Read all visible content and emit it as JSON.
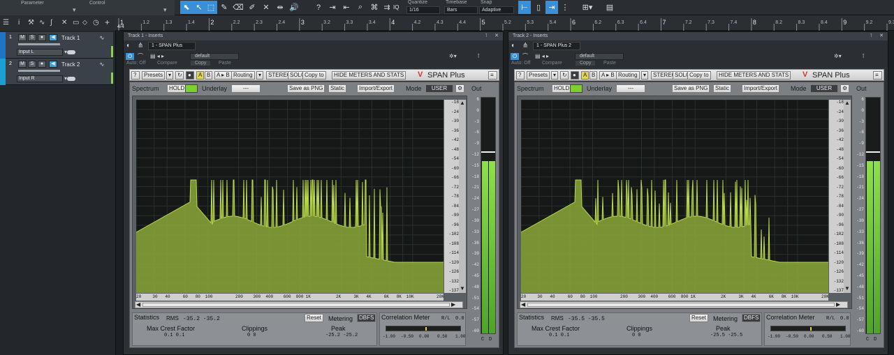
{
  "topbar": {
    "parameter_label": "Parameter",
    "control_label": "Control",
    "quantize_label": "Quantize",
    "quantize_value": "1/16",
    "timebase_label": "Timebase",
    "timebase_value": "Bars",
    "snap_label": "Snap",
    "snap_value": "Adaptive",
    "iq_label": "IQ"
  },
  "ruler": {
    "ticks": [
      "1",
      "1.2",
      "1.3",
      "1.4",
      "2",
      "2.2",
      "2.3",
      "2.4",
      "3",
      "3.2",
      "3.3",
      "3.4",
      "4",
      "4.2",
      "4.3",
      "4.4",
      "5",
      "5.2",
      "5.3",
      "5.4",
      "6",
      "6.2",
      "6.3",
      "6.4",
      "7",
      "7.2",
      "7.3",
      "7.4",
      "8",
      "8.2",
      "8.3",
      "8.4",
      "9",
      "9.2",
      "9.3"
    ],
    "signature": "4/4"
  },
  "tracks": [
    {
      "number": "1",
      "name": "Track 1",
      "input": "Input L",
      "mute": "M",
      "solo": "S"
    },
    {
      "number": "2",
      "name": "Track 2",
      "input": "Input R",
      "mute": "M",
      "solo": "S"
    }
  ],
  "plugins": [
    {
      "window_title": "Track 1 - Inserts",
      "insert_name": "1 - SPAN Plus",
      "preset": "default",
      "auto": "Auto: Off",
      "compare": "Compare",
      "copy": "Copy",
      "paste": "Paste",
      "rms_label": "RMS",
      "rms_values": "-35.2  -35.2",
      "crest_values": "0.1    0.1",
      "clip_values": "0      0",
      "peak_values": "-25.2  -25.2",
      "corr_value": "0.0",
      "out_level": 0.73
    },
    {
      "window_title": "Track 2 - Inserts",
      "insert_name": "1 - SPAN Plus 2",
      "preset": "default",
      "auto": "Auto: Off",
      "compare": "Compare",
      "copy": "Copy",
      "paste": "Paste",
      "rms_label": "RMS",
      "rms_values": "-35.5  -35.5",
      "crest_values": "0.1    0.1",
      "clip_values": "0      0",
      "peak_values": "-25.5  -25.5",
      "corr_value": "0.0",
      "out_level": 0.73
    }
  ],
  "span": {
    "help": "?",
    "presets": "Presets",
    "ab_a": "A",
    "ab_b": "B",
    "ab_copy": "A ▸ B",
    "routing": "Routing",
    "stereo": "STEREO",
    "solo": "SOLO",
    "copy_to": "Copy to",
    "hide": "HIDE METERS AND STATS",
    "brand": "SPAN Plus",
    "spectrum": "Spectrum",
    "hold": "HOLD",
    "underlay": "Underlay",
    "underlay_value": "---",
    "save_png": "Save as PNG",
    "static": "Static",
    "import_export": "Import/Export",
    "mode": "Mode",
    "mode_value": "USER",
    "out": "Out",
    "statistics": "Statistics",
    "reset": "Reset",
    "metering": "Metering",
    "dbfs": "DBFS",
    "max_crest": "Max Crest Factor",
    "clippings": "Clippings",
    "peak": "Peak",
    "correlation": "Correlation Meter",
    "corr_ra": "R/L",
    "corr_ticks": [
      "-1.00",
      "-0.50",
      "0.00",
      "0.50",
      "1.00"
    ],
    "freq_ticks": [
      "20",
      "30",
      "40",
      "60",
      "80",
      "100",
      "200",
      "300",
      "400",
      "600",
      "800",
      "1K",
      "2K",
      "3K",
      "4K",
      "6K",
      "8K",
      "10K",
      "20K"
    ],
    "db_ticks": [
      "-18",
      "-24",
      "-30",
      "-36",
      "-42",
      "-48",
      "-54",
      "-60",
      "-66",
      "-72",
      "-78",
      "-84",
      "-90",
      "-96",
      "-102",
      "-108",
      "-114",
      "-120",
      "-126",
      "-132",
      "-137"
    ],
    "out_ticks": [
      "6",
      "0",
      "-3",
      "-6",
      "-9",
      "-12",
      "-15",
      "-18",
      "-21",
      "-24",
      "-27",
      "-30",
      "-33",
      "-36",
      "-39",
      "-42",
      "-45",
      "-48",
      "-51",
      "-54",
      "-57",
      "-60"
    ],
    "out_ch": [
      "C",
      "D"
    ]
  },
  "colors": {
    "accent": "#3b8fd6",
    "spectrum_fill": "#8aa83a",
    "spectrum_line": "#b9d94a",
    "meter_green": "#7ecb3a"
  }
}
